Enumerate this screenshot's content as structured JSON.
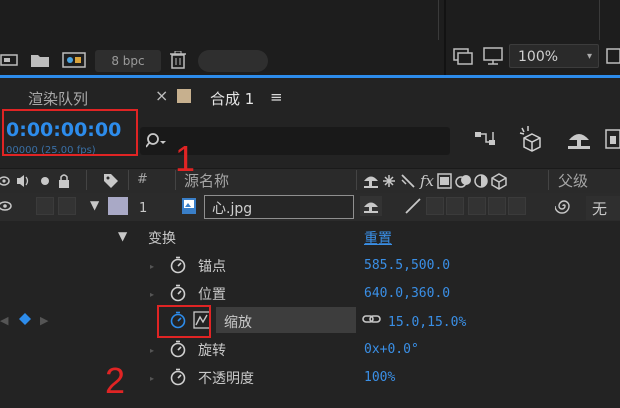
{
  "toolbar": {
    "bpc_label": "8 bpc",
    "zoom_value": "100%"
  },
  "tabs": {
    "render_queue": "渲染队列",
    "composition": "合成 1",
    "composition_menu": "≡"
  },
  "timeline": {
    "timecode": "0:00:00:00",
    "fps_text": "00000 (25.00 fps)"
  },
  "columns": {
    "hash": "#",
    "source_name": "源名称",
    "parent": "父级"
  },
  "layer": {
    "number": "1",
    "name": "心.jpg",
    "parent_value": "无"
  },
  "transform": {
    "label": "变换",
    "reset": "重置",
    "properties": [
      {
        "name": "锚点",
        "value": "585.5,500.0"
      },
      {
        "name": "位置",
        "value": "640.0,360.0"
      },
      {
        "name": "缩放",
        "value": "15.0,15.0%"
      },
      {
        "name": "旋转",
        "value": "0x+0.0°"
      },
      {
        "name": "不透明度",
        "value": "100%"
      }
    ]
  },
  "annotations": {
    "num1": "1",
    "num2": "2"
  },
  "colors": {
    "accent_blue": "#2d8ceb",
    "annotation_red": "#e02424",
    "label_lavender": "#a9a9c6"
  }
}
